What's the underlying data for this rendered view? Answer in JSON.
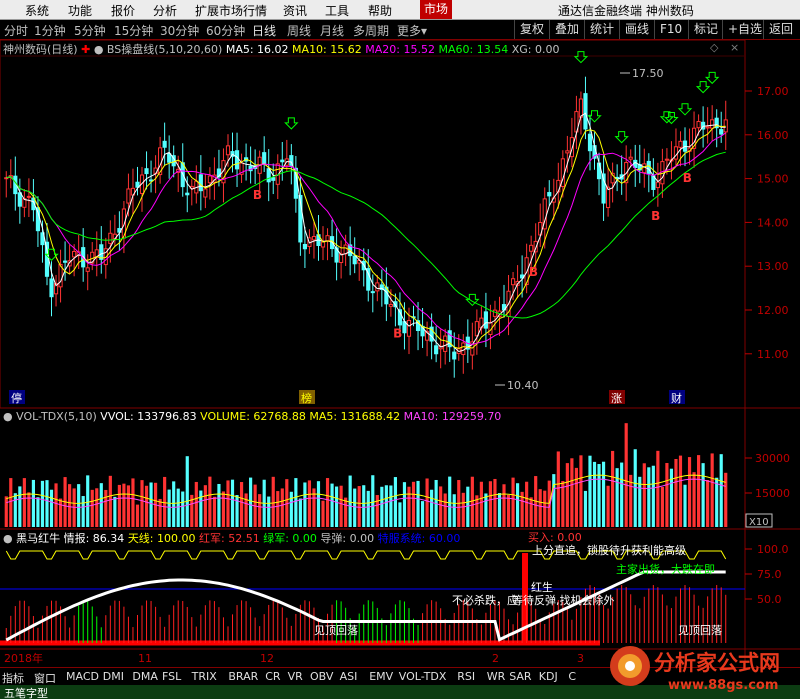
{
  "menu": {
    "items": [
      "系统",
      "功能",
      "报价",
      "分析",
      "扩展市场行情",
      "资讯",
      "工具",
      "帮助"
    ],
    "active": "市场",
    "right_title": "通达信金融终端 神州数码"
  },
  "toolbar": {
    "periods": [
      "分时",
      "1分钟",
      "5分钟",
      "15分钟",
      "30分钟",
      "60分钟",
      "日线",
      "周线",
      "月线",
      "多周期",
      "更多"
    ],
    "selected_period": "日线",
    "more_arrow": "▾",
    "right_buttons": [
      "复权",
      "叠加",
      "统计",
      "画线",
      "F10",
      "标记",
      "+自选",
      "返回"
    ]
  },
  "main_info": {
    "stock": "神州数码(日线)",
    "indicator": "BS操盘线(5,10,20,60)",
    "ma5": "MA5: 16.02",
    "ma10": "MA10: 15.62",
    "ma20": "MA20: 15.52",
    "ma60": "MA60: 13.54",
    "xg": "XG: 0.00"
  },
  "price_axis": [
    "17.00",
    "16.00",
    "15.00",
    "14.00",
    "13.00",
    "12.00",
    "11.00"
  ],
  "annotations": {
    "high": "17.50",
    "low": "10.40",
    "buy_mark": "B",
    "event_markers": [
      "停",
      "榜",
      "涨",
      "财"
    ]
  },
  "volume_info": {
    "name": "VOL-TDX(5,10)",
    "vvol": "VVOL: 133796.83",
    "volume": "VOLUME: 62768.88",
    "ma5": "MA5: 131688.42",
    "ma10": "MA10: 129259.70"
  },
  "volume_axis": [
    "30000",
    "15000"
  ],
  "volume_unit": "X10",
  "indicator_info": {
    "name": "黑马红牛",
    "qingbao": "情报: 86.34",
    "tianxian": "天线: 100.00",
    "hongjun": "红军: 52.51",
    "lvjun": "绿军: 0.00",
    "daotan": "导弹: 0.00",
    "tail": "特服系统: 60.00"
  },
  "indicator_axis": [
    "100.0",
    "75.0",
    "50.0"
  ],
  "indicator_texts": {
    "buy_in": "买入: 0.00",
    "top_text": "上分直追，锁股待升获利能高级",
    "no_panic": "不必杀跌，应",
    "overlap": "等待反弹,找机会除外",
    "red_born": "红生",
    "zhuangjia": "主家出货，大跌在即",
    "jian_ding_1": "见顶回落",
    "jian_ding_2": "见顶回落"
  },
  "dates": {
    "year": "2018年",
    "m11": "11",
    "m12": "12",
    "m2": "2",
    "m3": "3"
  },
  "bottom_tabs": [
    "指标",
    "窗口",
    "MACD",
    "DMI",
    "DMA",
    "FSL",
    "TRIX",
    "BRAR",
    "CR",
    "VR",
    "OBV",
    "ASI",
    "EMV",
    "VOL-TDX",
    "RSI",
    "WR",
    "SAR",
    "KDJ",
    "C"
  ],
  "status": "五笔字型",
  "watermark": {
    "brand": "分析家公式网",
    "url": "www.88gs.com"
  },
  "colors": {
    "up": "#ff3333",
    "down": "#54ffff",
    "ma5": "#ffffff",
    "ma10": "#ffff00",
    "ma20": "#ff00ff",
    "ma60": "#00ff00",
    "volume_ma10": "#ff44ff",
    "panel_border": "#800000"
  },
  "icons": {
    "toggle": "toggle-icon",
    "diamond": "diamond-icon",
    "close": "close-icon"
  }
}
